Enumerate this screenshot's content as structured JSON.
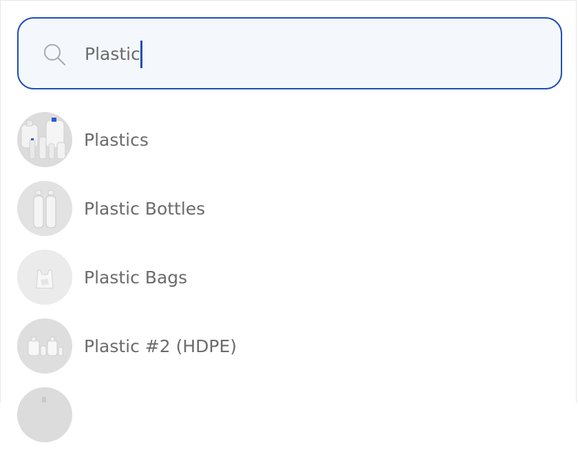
{
  "search": {
    "value": "Plastic",
    "icon": "search-icon"
  },
  "results": [
    {
      "label": "Plastics",
      "thumbnail": "assorted-plastic-jugs"
    },
    {
      "label": "Plastic Bottles",
      "thumbnail": "clear-plastic-bottles"
    },
    {
      "label": "Plastic Bags",
      "thumbnail": "plastic-bag"
    },
    {
      "label": "Plastic #2 (HDPE)",
      "thumbnail": "hdpe-bottles"
    },
    {
      "label": "",
      "thumbnail": "partially-visible-item"
    }
  ],
  "colors": {
    "accent": "#1d4fb3",
    "text": "#6b6b6b",
    "search_bg": "#f4f8fd",
    "thumb_bg": "#e6e6e6"
  }
}
